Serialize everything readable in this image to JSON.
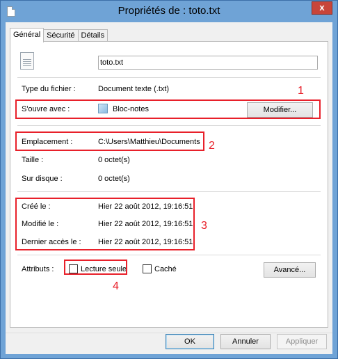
{
  "window": {
    "title": "Propriétés de : toto.txt",
    "close_glyph": "x"
  },
  "tabs": [
    {
      "label": "Général",
      "active": true
    },
    {
      "label": "Sécurité",
      "active": false
    },
    {
      "label": "Détails",
      "active": false
    }
  ],
  "general": {
    "filename": "toto.txt",
    "type_label": "Type du fichier :",
    "type_value": "Document texte (.txt)",
    "opens_label": "S'ouvre avec :",
    "opens_value": "Bloc-notes",
    "modify_button": "Modifier...",
    "location_label": "Emplacement :",
    "location_value": "C:\\Users\\Matthieu\\Documents",
    "size_label": "Taille :",
    "size_value": "0 octet(s)",
    "disk_label": "Sur disque :",
    "disk_value": "0 octet(s)",
    "created_label": "Créé le :",
    "created_value": "Hier 22 août 2012, 19:16:51",
    "modified_label": "Modifié le :",
    "modified_value": "Hier 22 août 2012, 19:16:51",
    "accessed_label": "Dernier accès le :",
    "accessed_value": "Hier 22 août 2012, 19:16:51",
    "attributes_label": "Attributs :",
    "readonly_label": "Lecture seule",
    "readonly_checked": false,
    "hidden_label": "Caché",
    "hidden_checked": false,
    "advanced_button": "Avancé..."
  },
  "footer": {
    "ok": "OK",
    "cancel": "Annuler",
    "apply": "Appliquer"
  },
  "annotations": {
    "one": "1",
    "two": "2",
    "three": "3",
    "four": "4",
    "color": "#e8202a"
  },
  "colors": {
    "titlebar": "#6fa3d6",
    "close": "#c8453a",
    "dialog_bg": "#f0f0f0"
  }
}
